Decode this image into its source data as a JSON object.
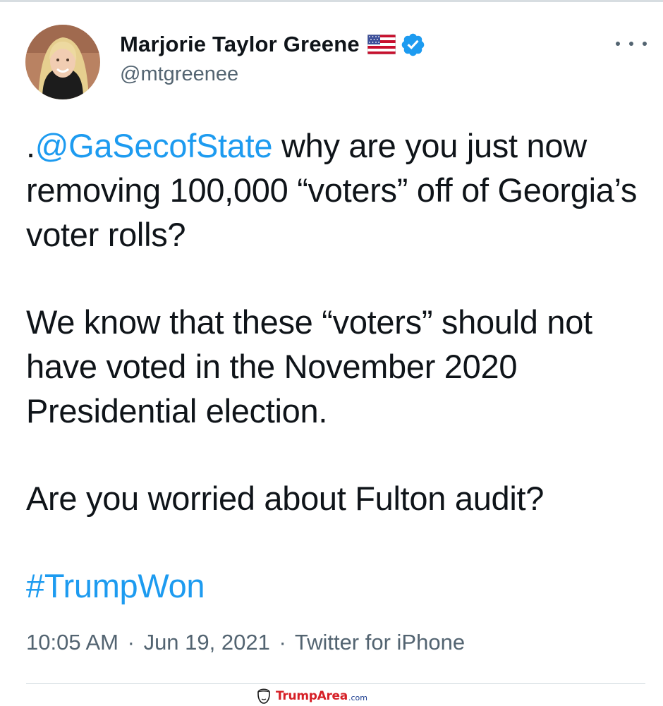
{
  "author": {
    "display_name": "Marjorie Taylor Greene",
    "handle": "@mtgreenee",
    "flag_icon": "us-flag-icon",
    "verified_icon": "verified-badge-icon"
  },
  "menu": {
    "more_icon": "more-options-icon"
  },
  "tweet": {
    "paragraphs": [
      {
        "prefix": ".",
        "mention": "@GaSecofState",
        "text": " why are you just now removing 100,000 “voters” off of Georgia’s voter rolls?"
      },
      {
        "text": "We know that these “voters” should not have voted in the November 2020 Presidential election."
      },
      {
        "text": "Are you worried about Fulton audit?"
      },
      {
        "hashtag": "#TrumpWon"
      }
    ]
  },
  "meta": {
    "time": "10:05 AM",
    "date": "Jun 19, 2021",
    "separator": "·",
    "source": "Twitter for iPhone"
  },
  "watermark": {
    "brand": "TrumpArea",
    "tld": ".com"
  },
  "colors": {
    "link": "#1d9bf0",
    "text": "#0f1419",
    "secondary": "#536471"
  }
}
